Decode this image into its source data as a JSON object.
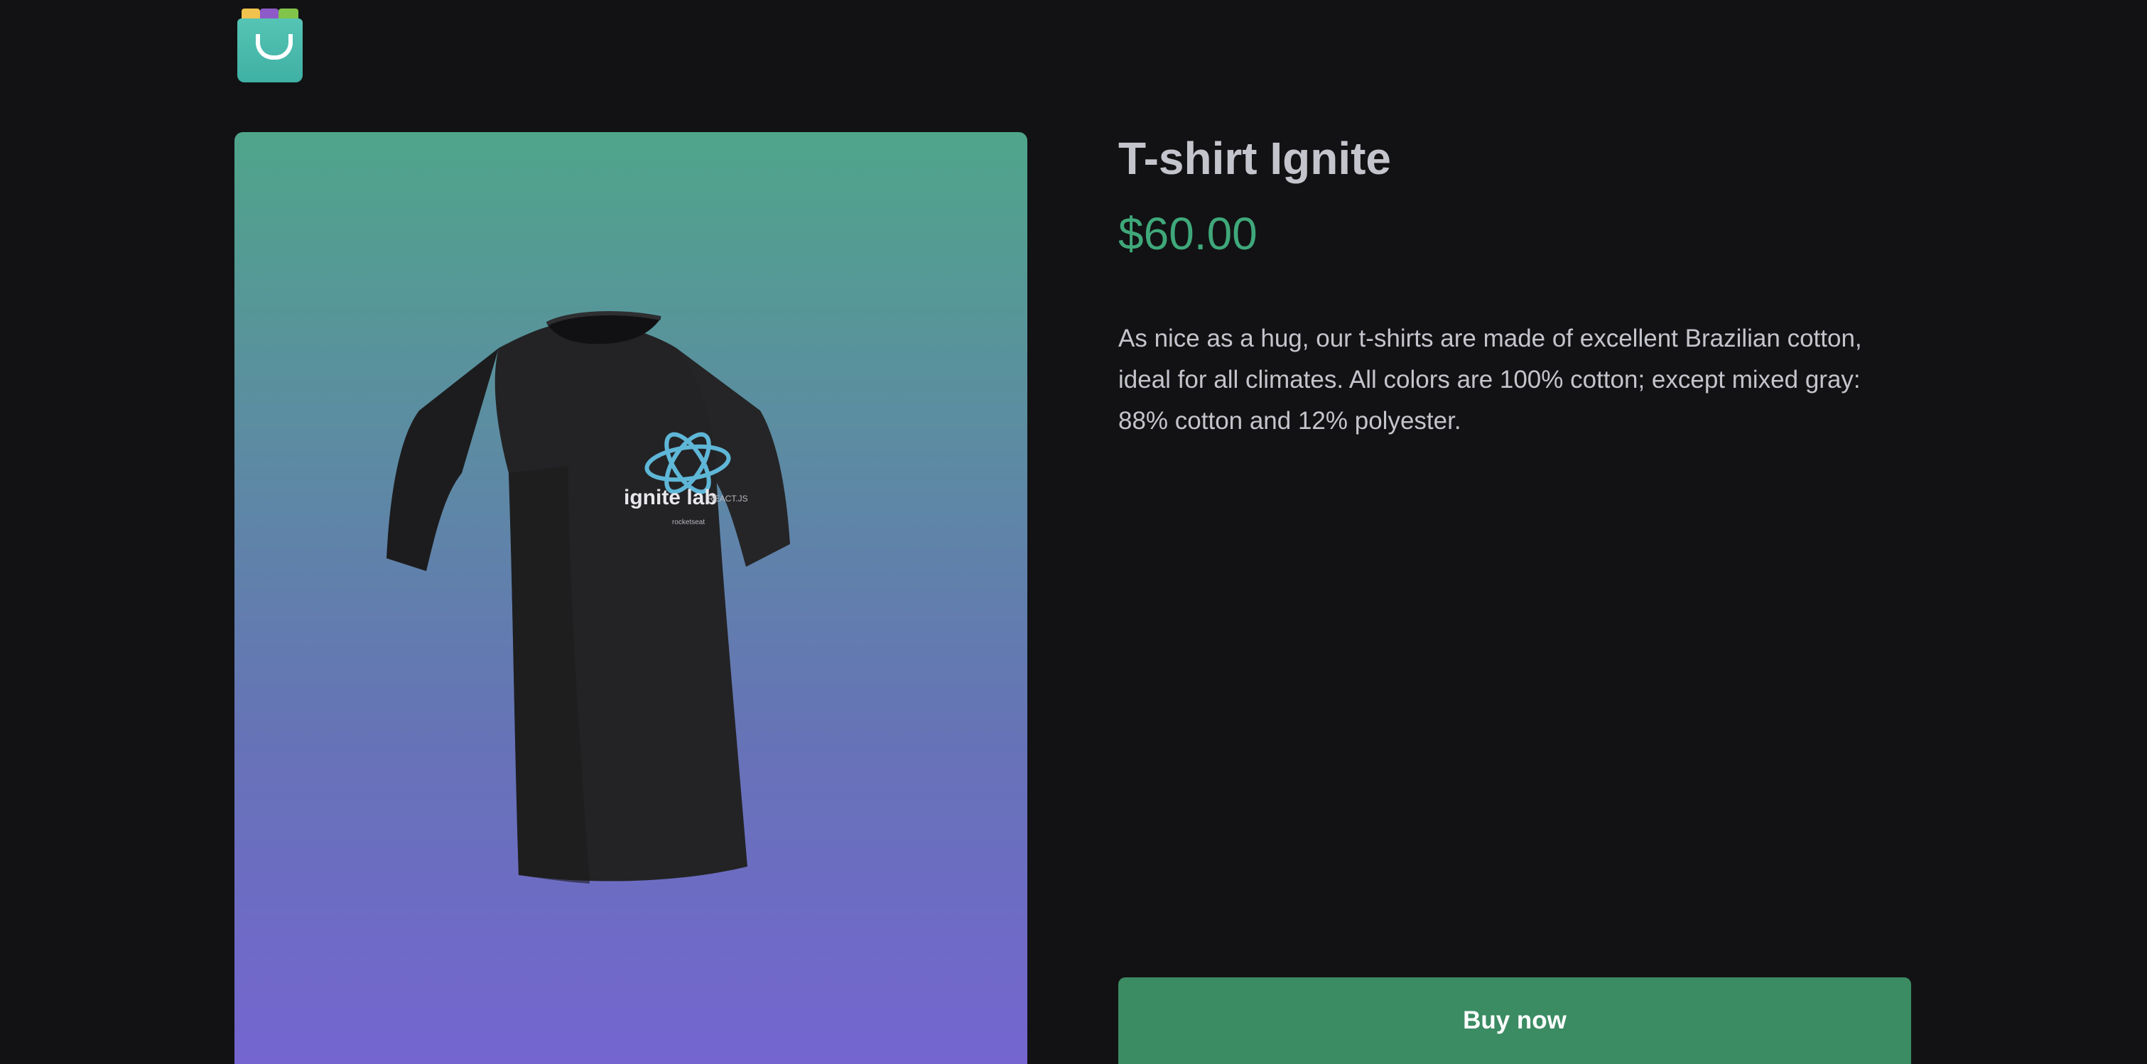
{
  "header": {
    "logo_icon": "shopping-bag-icon"
  },
  "product": {
    "title": "T-shirt Ignite",
    "price": "$60.00",
    "description": "As nice as a hug, our t-shirts are made of excellent Brazilian cotton, ideal for all climates. All colors are 100% cotton; except mixed gray: 88% cotton and 12% polyester.",
    "buy_label": "Buy now",
    "image": {
      "print_main": "ignite lab",
      "print_side": "REACT.JS",
      "print_sponsor": "rocketseat"
    }
  },
  "colors": {
    "background": "#121214",
    "title_text": "#c4c4cc",
    "price": "#3fa87a",
    "button": "#3b8b63",
    "gradient_top": "#4fa58a",
    "gradient_bottom": "#7465d0"
  }
}
